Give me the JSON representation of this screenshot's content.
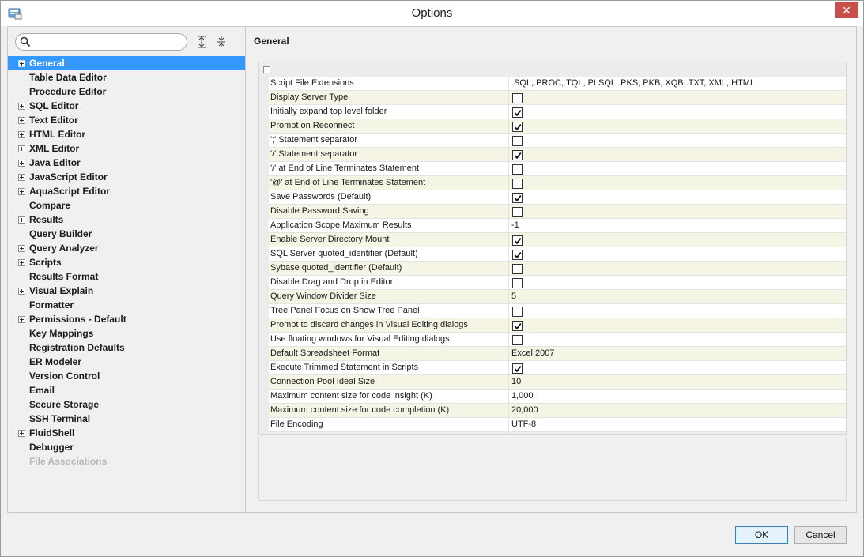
{
  "window": {
    "title": "Options",
    "close_label": "✕"
  },
  "search": {
    "value": "",
    "placeholder": ""
  },
  "tree": [
    {
      "label": "General",
      "expandable": true,
      "selected": true,
      "disabled": false
    },
    {
      "label": "Table Data Editor",
      "expandable": false,
      "selected": false,
      "disabled": false
    },
    {
      "label": "Procedure Editor",
      "expandable": false,
      "selected": false,
      "disabled": false
    },
    {
      "label": "SQL Editor",
      "expandable": true,
      "selected": false,
      "disabled": false
    },
    {
      "label": "Text Editor",
      "expandable": true,
      "selected": false,
      "disabled": false
    },
    {
      "label": "HTML Editor",
      "expandable": true,
      "selected": false,
      "disabled": false
    },
    {
      "label": "XML Editor",
      "expandable": true,
      "selected": false,
      "disabled": false
    },
    {
      "label": "Java Editor",
      "expandable": true,
      "selected": false,
      "disabled": false
    },
    {
      "label": "JavaScript Editor",
      "expandable": true,
      "selected": false,
      "disabled": false
    },
    {
      "label": "AquaScript Editor",
      "expandable": true,
      "selected": false,
      "disabled": false
    },
    {
      "label": "Compare",
      "expandable": false,
      "selected": false,
      "disabled": false
    },
    {
      "label": "Results",
      "expandable": true,
      "selected": false,
      "disabled": false
    },
    {
      "label": "Query Builder",
      "expandable": false,
      "selected": false,
      "disabled": false
    },
    {
      "label": "Query Analyzer",
      "expandable": true,
      "selected": false,
      "disabled": false
    },
    {
      "label": "Scripts",
      "expandable": true,
      "selected": false,
      "disabled": false
    },
    {
      "label": "Results Format",
      "expandable": false,
      "selected": false,
      "disabled": false
    },
    {
      "label": "Visual Explain",
      "expandable": true,
      "selected": false,
      "disabled": false
    },
    {
      "label": "Formatter",
      "expandable": false,
      "selected": false,
      "disabled": false
    },
    {
      "label": "Permissions - Default",
      "expandable": true,
      "selected": false,
      "disabled": false
    },
    {
      "label": "Key Mappings",
      "expandable": false,
      "selected": false,
      "disabled": false
    },
    {
      "label": "Registration Defaults",
      "expandable": false,
      "selected": false,
      "disabled": false
    },
    {
      "label": "ER Modeler",
      "expandable": false,
      "selected": false,
      "disabled": false
    },
    {
      "label": "Version Control",
      "expandable": false,
      "selected": false,
      "disabled": false
    },
    {
      "label": "Email",
      "expandable": false,
      "selected": false,
      "disabled": false
    },
    {
      "label": "Secure Storage",
      "expandable": false,
      "selected": false,
      "disabled": false
    },
    {
      "label": "SSH Terminal",
      "expandable": false,
      "selected": false,
      "disabled": false
    },
    {
      "label": "FluidShell",
      "expandable": true,
      "selected": false,
      "disabled": false
    },
    {
      "label": "Debugger",
      "expandable": false,
      "selected": false,
      "disabled": false
    },
    {
      "label": "File Associations",
      "expandable": false,
      "selected": false,
      "disabled": true
    }
  ],
  "section": {
    "title": "General"
  },
  "properties": [
    {
      "label": "Script File Extensions",
      "type": "text",
      "value": ".SQL,.PROC,.TQL,.PLSQL,.PKS,.PKB,.XQB,.TXT,.XML,.HTML"
    },
    {
      "label": "Display Server Type",
      "type": "checkbox",
      "checked": false
    },
    {
      "label": "Initially expand top level folder",
      "type": "checkbox",
      "checked": true
    },
    {
      "label": "Prompt on Reconnect",
      "type": "checkbox",
      "checked": true
    },
    {
      "label": "';' Statement separator",
      "type": "checkbox",
      "checked": false
    },
    {
      "label": "'/' Statement separator",
      "type": "checkbox",
      "checked": true
    },
    {
      "label": "'/' at End of Line Terminates Statement",
      "type": "checkbox",
      "checked": false
    },
    {
      "label": "'@' at End of Line Terminates Statement",
      "type": "checkbox",
      "checked": false
    },
    {
      "label": "Save Passwords (Default)",
      "type": "checkbox",
      "checked": true
    },
    {
      "label": "Disable Password Saving",
      "type": "checkbox",
      "checked": false
    },
    {
      "label": "Application Scope Maximum Results",
      "type": "text",
      "value": "-1"
    },
    {
      "label": "Enable Server Directory Mount",
      "type": "checkbox",
      "checked": true
    },
    {
      "label": "SQL Server quoted_identifier (Default)",
      "type": "checkbox",
      "checked": true
    },
    {
      "label": "Sybase quoted_identifier (Default)",
      "type": "checkbox",
      "checked": false
    },
    {
      "label": "Disable Drag and Drop in Editor",
      "type": "checkbox",
      "checked": false
    },
    {
      "label": "Query Window Divider Size",
      "type": "text",
      "value": "5"
    },
    {
      "label": "Tree Panel Focus on Show Tree Panel",
      "type": "checkbox",
      "checked": false
    },
    {
      "label": "Prompt to discard changes in Visual Editing dialogs",
      "type": "checkbox",
      "checked": true
    },
    {
      "label": "Use floating windows for Visual Editing dialogs",
      "type": "checkbox",
      "checked": false
    },
    {
      "label": "Default Spreadsheet Format",
      "type": "text",
      "value": "Excel 2007"
    },
    {
      "label": "Execute Trimmed Statement in Scripts",
      "type": "checkbox",
      "checked": true
    },
    {
      "label": "Connection Pool Ideal Size",
      "type": "text",
      "value": "10"
    },
    {
      "label": "Maximum content size for code insight (K)",
      "type": "text",
      "value": "1,000"
    },
    {
      "label": "Maximum content size for code completion (K)",
      "type": "text",
      "value": "20,000"
    },
    {
      "label": "File Encoding",
      "type": "text",
      "value": "UTF-8"
    }
  ],
  "buttons": {
    "ok": "OK",
    "cancel": "Cancel"
  },
  "colors": {
    "selection": "#3399ff",
    "row_alt": "#f5f5e5",
    "close_button": "#c7504a"
  }
}
